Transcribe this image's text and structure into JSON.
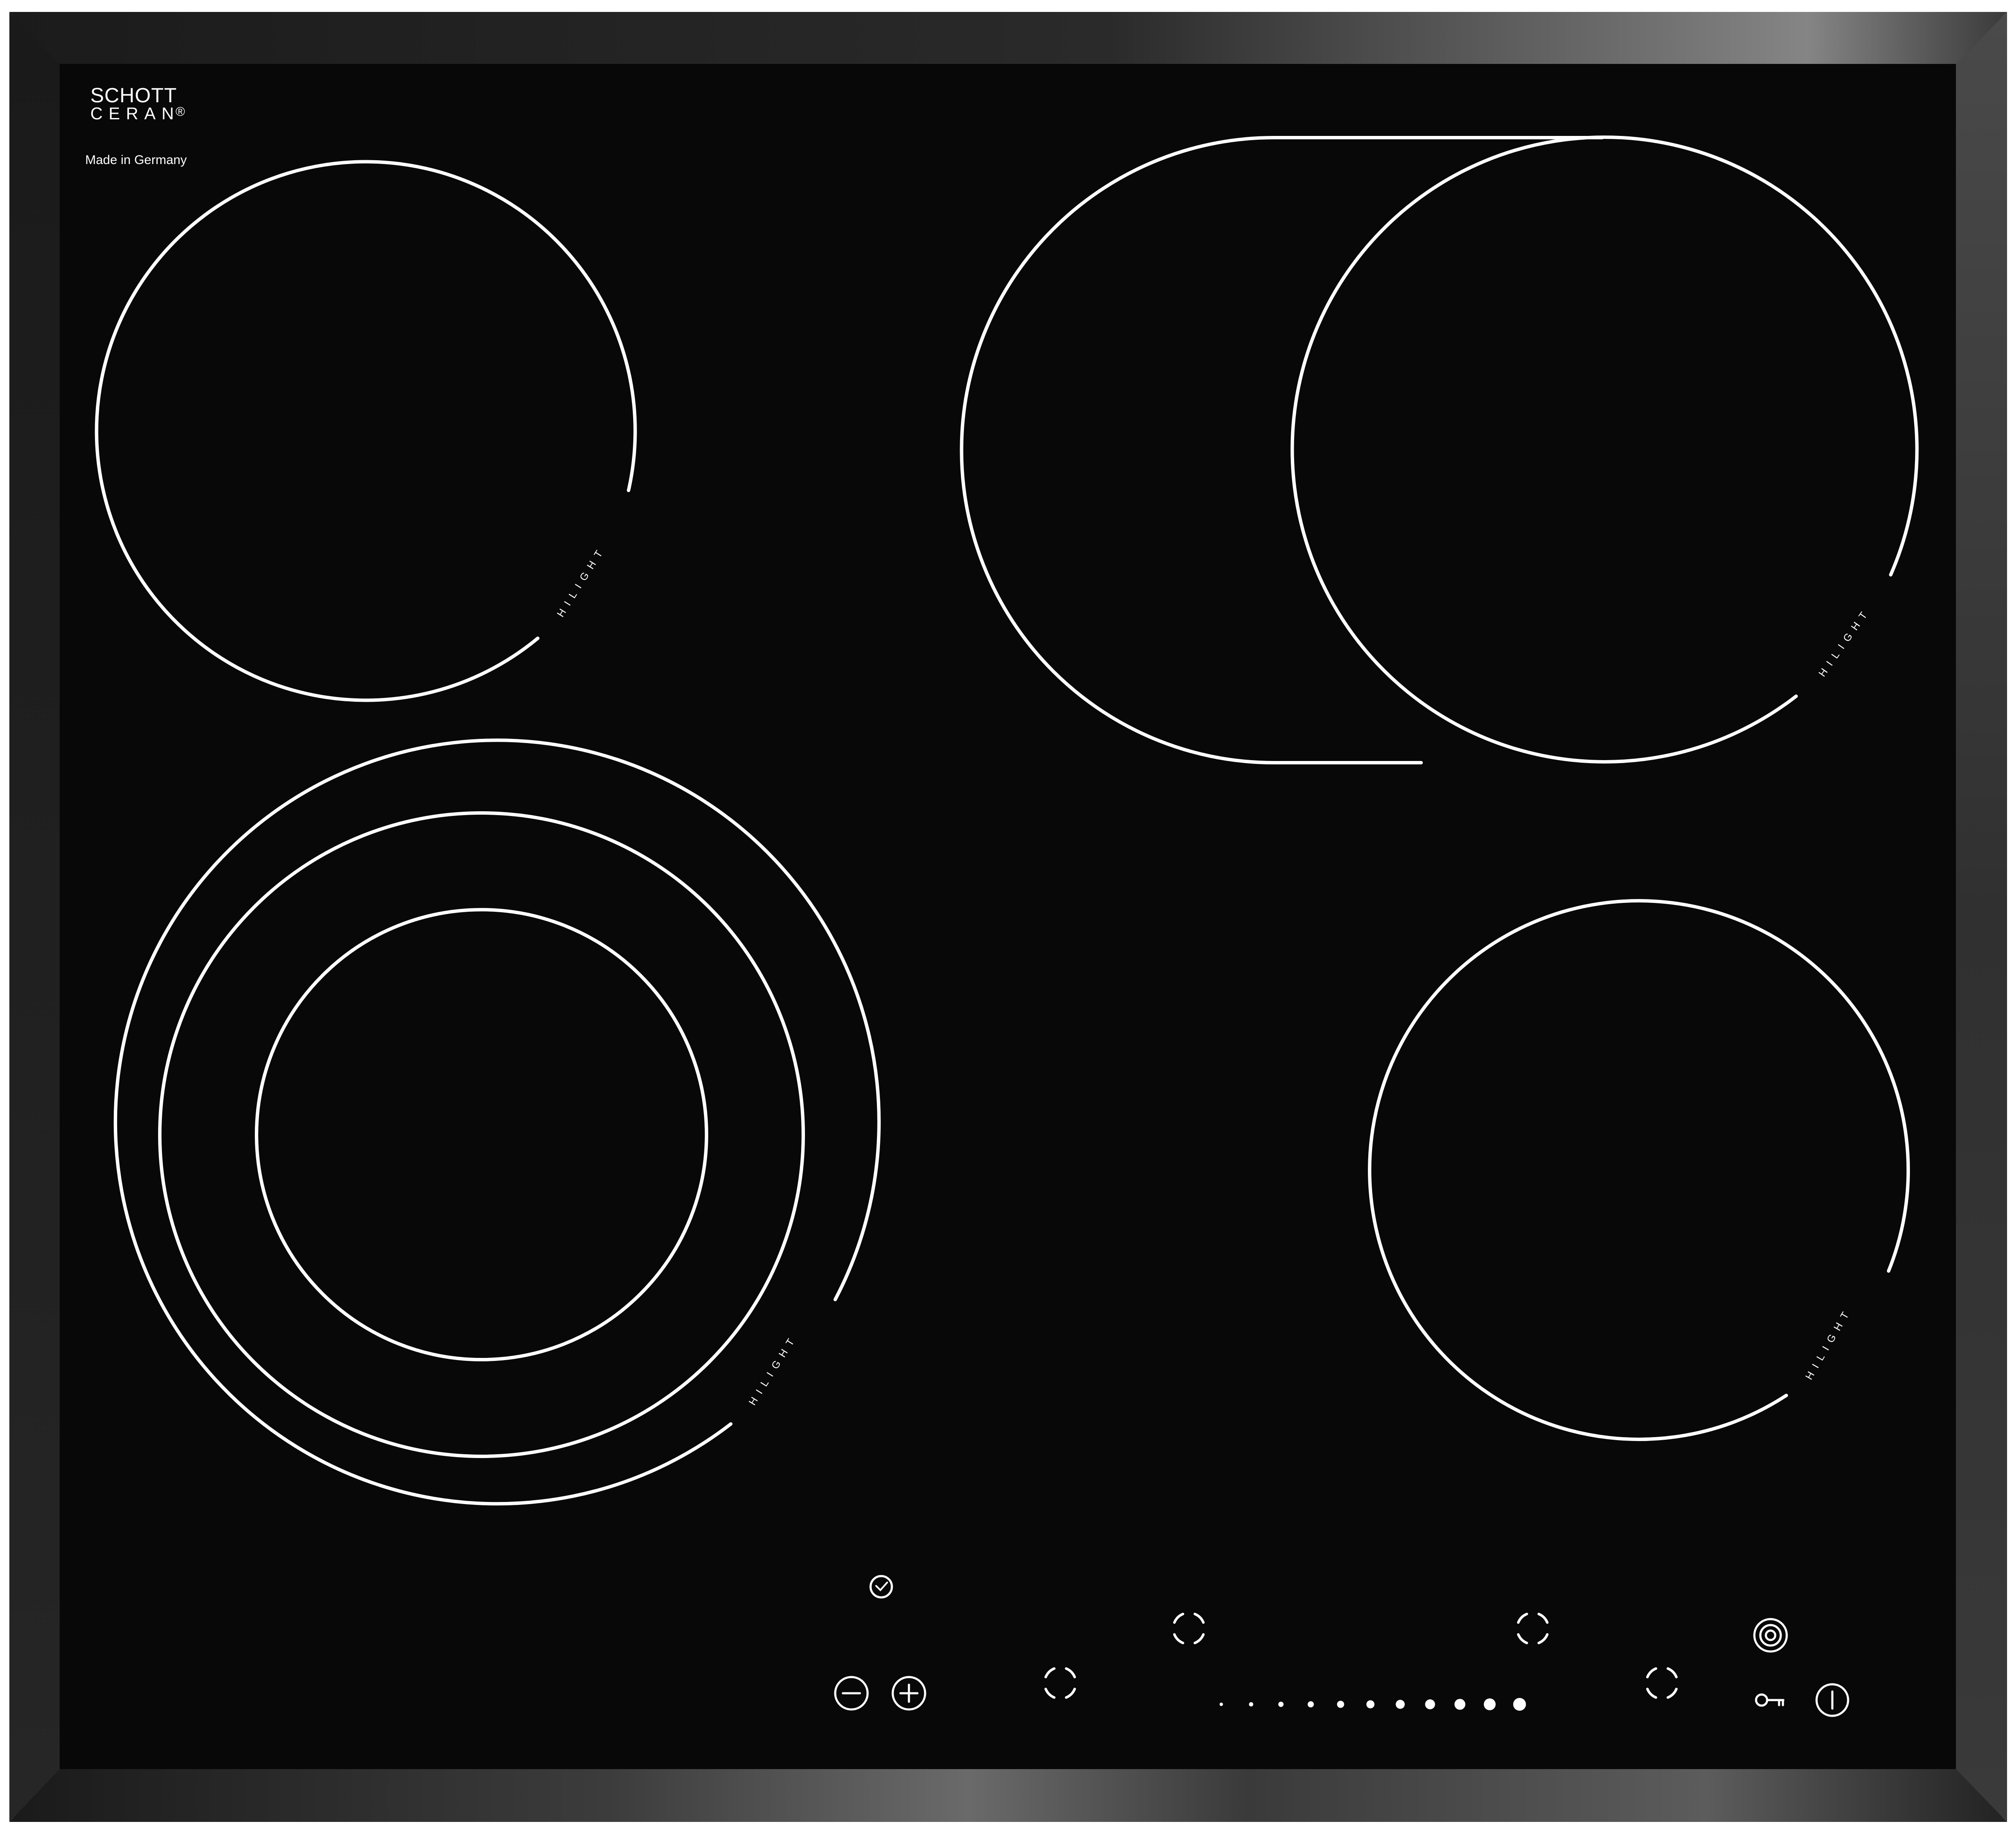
{
  "branding": {
    "brand_line1": "SCHOTT",
    "brand_line2": "CERAN",
    "registered_mark": "®",
    "origin": "Made in Germany"
  },
  "zones": [
    {
      "id": "zone-top-left",
      "label": "HILIGHT"
    },
    {
      "id": "zone-top-right-oval",
      "label": "HILIGHT"
    },
    {
      "id": "zone-bottom-left-triple",
      "label": "HILIGHT"
    },
    {
      "id": "zone-bottom-right",
      "label": "HILIGHT"
    }
  ],
  "controls": {
    "timer_icon": "clock-icon",
    "minus_icon": "minus-icon",
    "plus_icon": "plus-icon",
    "zone_selector_icon": "zone-selector-icon",
    "oval_extension_icon": "dual-ring-icon",
    "lock_icon": "key-icon",
    "power_icon": "power-icon",
    "power_slider_steps": 11
  },
  "colors": {
    "glass": "#080808",
    "frame": "#2a2a2a",
    "print": "#ffffff"
  }
}
